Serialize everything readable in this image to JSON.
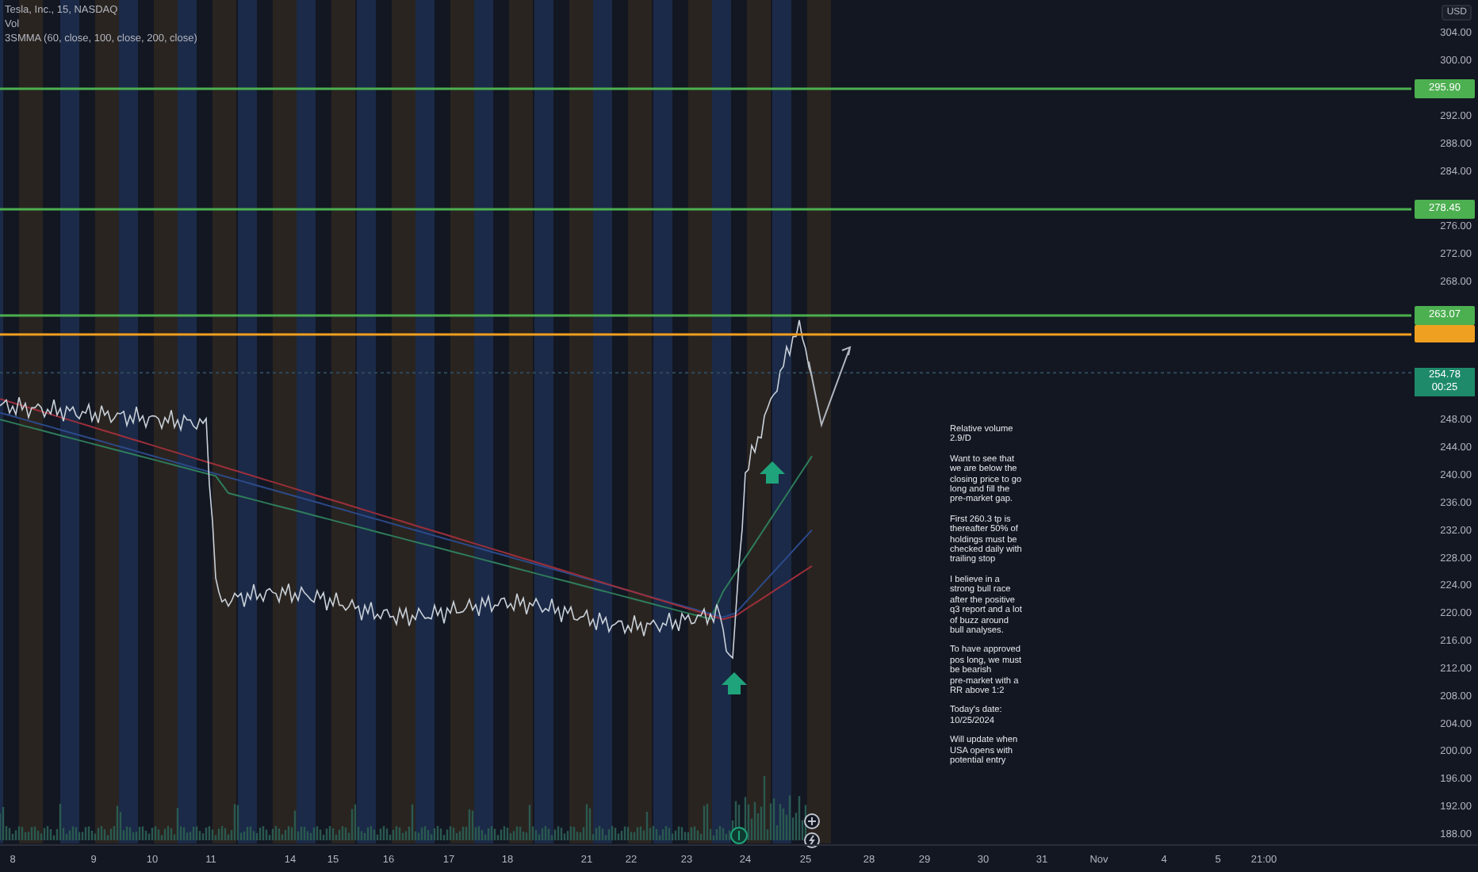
{
  "legend": [
    "Tesla, Inc., 15, NASDAQ",
    "Vol",
    "3SMMA (60, close, 100, close, 200, close)"
  ],
  "currency": "USD",
  "price_axis": [
    "304.00",
    "300.00",
    "292.00",
    "288.00",
    "284.00",
    "276.00",
    "272.00",
    "268.00",
    "248.00",
    "244.00",
    "240.00",
    "236.00",
    "232.00",
    "228.00",
    "224.00",
    "220.00",
    "216.00",
    "212.00",
    "208.00",
    "204.00",
    "200.00",
    "196.00",
    "192.00",
    "188.00"
  ],
  "levels": [
    {
      "price": "295.90",
      "color": "#4caf50"
    },
    {
      "price": "278.45",
      "color": "#4caf50"
    },
    {
      "price": "263.07",
      "color": "#4caf50"
    },
    {
      "color": "#f0a020"
    }
  ],
  "current_price": {
    "price": "254.78",
    "countdown": "00:25"
  },
  "note": [
    "Relative volume\n2.9/D",
    "Want to see that\nwe are below the\nclosing price to go\nlong and fill the\npre-market gap.",
    "First 260.3 tp is\nthereafter 50% of\nholdings must be\nchecked daily with\ntrailing stop",
    "I believe in a\nstrong bull race\nafter the positive\nq3 report and a lot\nof buzz around\nbull analyses.",
    "To have approved\npos long, we must\nbe bearish\npre-market with a\nRR above 1:2",
    "Today's date:\n10/25/2024",
    "Will update when\nUSA opens with\npotential entry"
  ],
  "date_axis": [
    "8",
    "9",
    "10",
    "11",
    "14",
    "15",
    "16",
    "17",
    "18",
    "21",
    "22",
    "23",
    "24",
    "25",
    "28",
    "29",
    "30",
    "31",
    "Nov",
    "4",
    "5",
    "21:00"
  ]
}
